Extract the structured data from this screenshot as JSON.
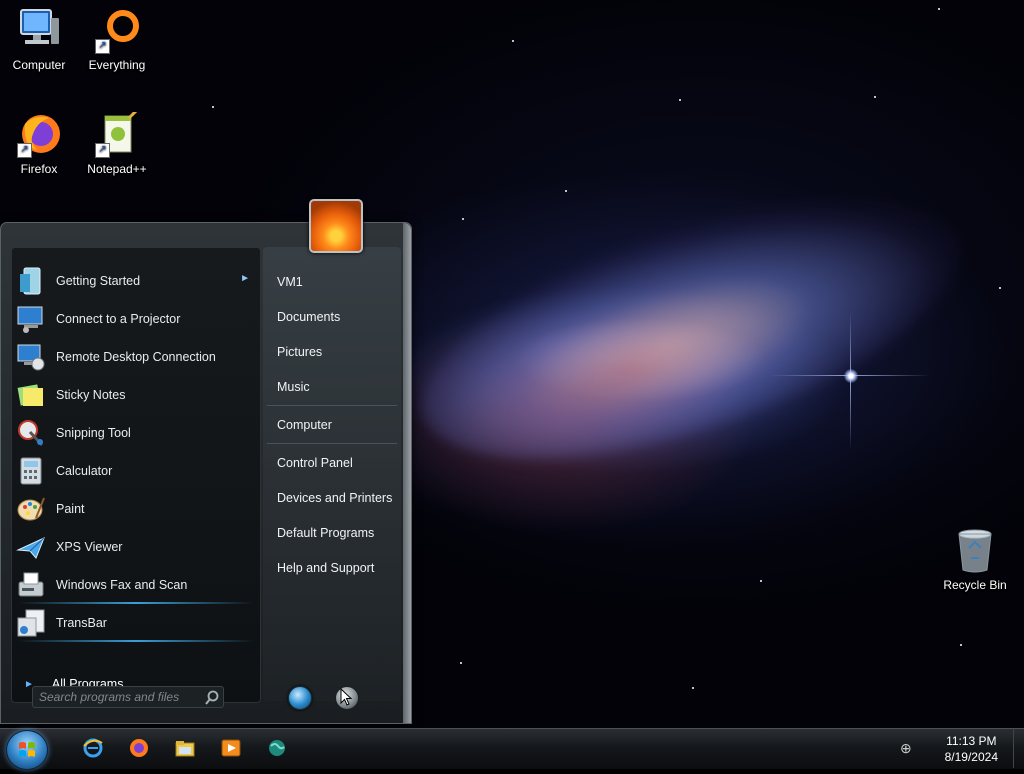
{
  "desktop": {
    "icons": [
      {
        "label": "Computer"
      },
      {
        "label": "Everything"
      },
      {
        "label": "Firefox"
      },
      {
        "label": "Notepad++"
      },
      {
        "label": "Recycle Bin"
      }
    ]
  },
  "start_menu": {
    "programs": [
      {
        "label": "Getting Started",
        "icon": "getting-started-icon",
        "has_submenu": true
      },
      {
        "label": "Connect to a Projector",
        "icon": "projector-icon"
      },
      {
        "label": "Remote Desktop Connection",
        "icon": "remote-desktop-icon"
      },
      {
        "label": "Sticky Notes",
        "icon": "sticky-notes-icon"
      },
      {
        "label": "Snipping Tool",
        "icon": "snipping-tool-icon"
      },
      {
        "label": "Calculator",
        "icon": "calculator-icon"
      },
      {
        "label": "Paint",
        "icon": "paint-icon"
      },
      {
        "label": "XPS Viewer",
        "icon": "xps-viewer-icon"
      },
      {
        "label": "Windows Fax and Scan",
        "icon": "fax-scan-icon"
      },
      {
        "label": "TransBar",
        "icon": "transbar-icon"
      }
    ],
    "all_programs_label": "All Programs",
    "places": [
      {
        "label": "VM1"
      },
      {
        "label": "Documents"
      },
      {
        "label": "Pictures"
      },
      {
        "label": "Music"
      },
      {
        "label": "Computer"
      },
      {
        "label": "Control Panel"
      },
      {
        "label": "Devices and Printers"
      },
      {
        "label": "Default Programs"
      },
      {
        "label": "Help and Support"
      }
    ],
    "search_placeholder": "Search programs and files"
  },
  "taskbar": {
    "pinned": [
      "internet-explorer-icon",
      "firefox-icon",
      "file-explorer-icon",
      "media-player-icon",
      "network-globe-icon"
    ],
    "clock_time": "11:13 PM",
    "clock_date": "8/19/2024"
  },
  "colors": {
    "accent": "#3a9fd8",
    "menu_bg": "#1a1e21",
    "taskbar_bg": "#0b0d0f"
  }
}
